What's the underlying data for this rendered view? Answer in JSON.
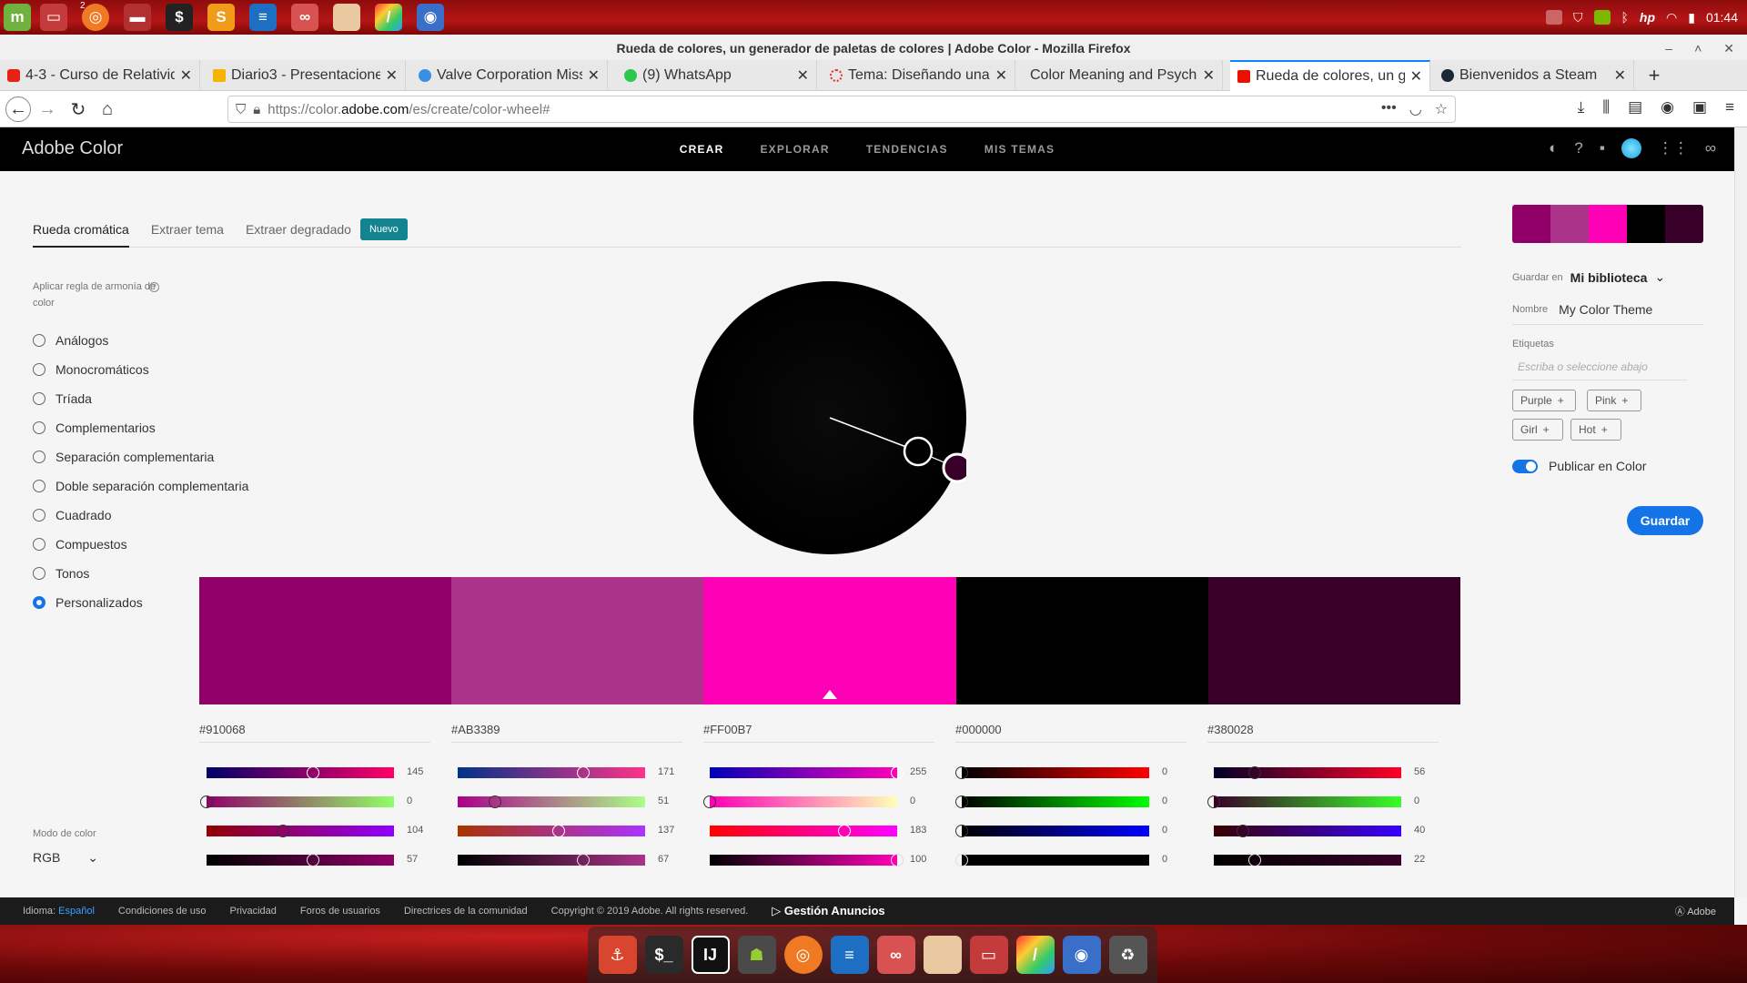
{
  "os": {
    "clock": "01:44",
    "taskbar_badge": "2",
    "taskbar_icons": [
      "mint-menu-icon",
      "folder-icon",
      "firefox-icon",
      "files-icon",
      "terminal-icon",
      "sublime-icon",
      "text-editor-icon",
      "glasses-icon",
      "archive-icon",
      "color-picker-icon",
      "screenshot-icon"
    ]
  },
  "browser": {
    "window_title": "Rueda de colores, un generador de paletas de colores | Adobe Color - Mozilla Firefox",
    "tabs": [
      {
        "label": "4-3 - Curso de Relativid",
        "color": "#e62117"
      },
      {
        "label": "Diario3 - Presentacione",
        "color": "#f4b400"
      },
      {
        "label": "Valve Corporation Miss",
        "color": "#3a8ee6"
      },
      {
        "label": "(9) WhatsApp",
        "color": "#2cc84d"
      },
      {
        "label": "Tema: Diseñando una",
        "color": "#e6332a"
      },
      {
        "label": "Color Meaning and Psych",
        "color": ""
      },
      {
        "label": "Rueda de colores, un g",
        "color": "#eb1000"
      },
      {
        "label": "Bienvenidos a Steam",
        "color": "#1b2838"
      }
    ],
    "url_prefix": "https://color.",
    "url_domain": "adobe.com",
    "url_suffix": "/es/create/color-wheel#"
  },
  "adobe": {
    "logo": "Adobe Color",
    "nav": [
      "CREAR",
      "EXPLORAR",
      "TENDENCIAS",
      "MIS TEMAS"
    ],
    "subtabs": {
      "wheel": "Rueda cromática",
      "extract_theme": "Extraer tema",
      "extract_gradient": "Extraer degradado",
      "badge": "Nuevo"
    },
    "harmony_label": "Aplicar regla de armonía de color",
    "harmony_rules": [
      "Análogos",
      "Monocromáticos",
      "Tríada",
      "Complementarios",
      "Separación complementaria",
      "Doble separación complementaria",
      "Cuadrado",
      "Compuestos",
      "Tonos",
      "Personalizados"
    ],
    "selected_rule_index": 9,
    "mode_label": "Modo de color",
    "mode_value": "RGB",
    "swatches": [
      {
        "hex": "#910068",
        "rgb": [
          145,
          0,
          104
        ],
        "extra": 57
      },
      {
        "hex": "#AB3389",
        "rgb": [
          171,
          51,
          137
        ],
        "extra": 67
      },
      {
        "hex": "#FF00B7",
        "rgb": [
          255,
          0,
          183
        ],
        "extra": 100
      },
      {
        "hex": "#000000",
        "rgb": [
          0,
          0,
          0
        ],
        "extra": 0
      },
      {
        "hex": "#380028",
        "rgb": [
          56,
          0,
          40
        ],
        "extra": 22
      }
    ],
    "selected_swatch_index": 2,
    "save_in_label": "Guardar en",
    "save_in_value": "Mi biblioteca",
    "name_label": "Nombre",
    "name_value": "My Color Theme",
    "tags_label": "Etiquetas",
    "tags_placeholder": "Escriba o seleccione abajo",
    "tags": [
      "Purple",
      "Pink",
      "Girl",
      "Hot"
    ],
    "publish_label": "Publicar en Color",
    "save_button": "Guardar"
  },
  "footer": {
    "lang_label": "Idioma:",
    "lang_value": "Español",
    "links": [
      "Condiciones de uso",
      "Privacidad",
      "Foros de usuarios",
      "Directrices de la comunidad"
    ],
    "copyright": "Copyright © 2019 Adobe. All rights reserved.",
    "ads": "Gestión Anuncios",
    "brand": "Adobe"
  },
  "dock_icons": [
    "anchor-icon",
    "terminal-icon",
    "intellij-icon",
    "android-icon",
    "firefox-icon",
    "text-editor-icon",
    "glasses-icon",
    "archive-icon",
    "folder-icon",
    "color-picker-icon",
    "screenshot-icon",
    "trash-icon"
  ]
}
